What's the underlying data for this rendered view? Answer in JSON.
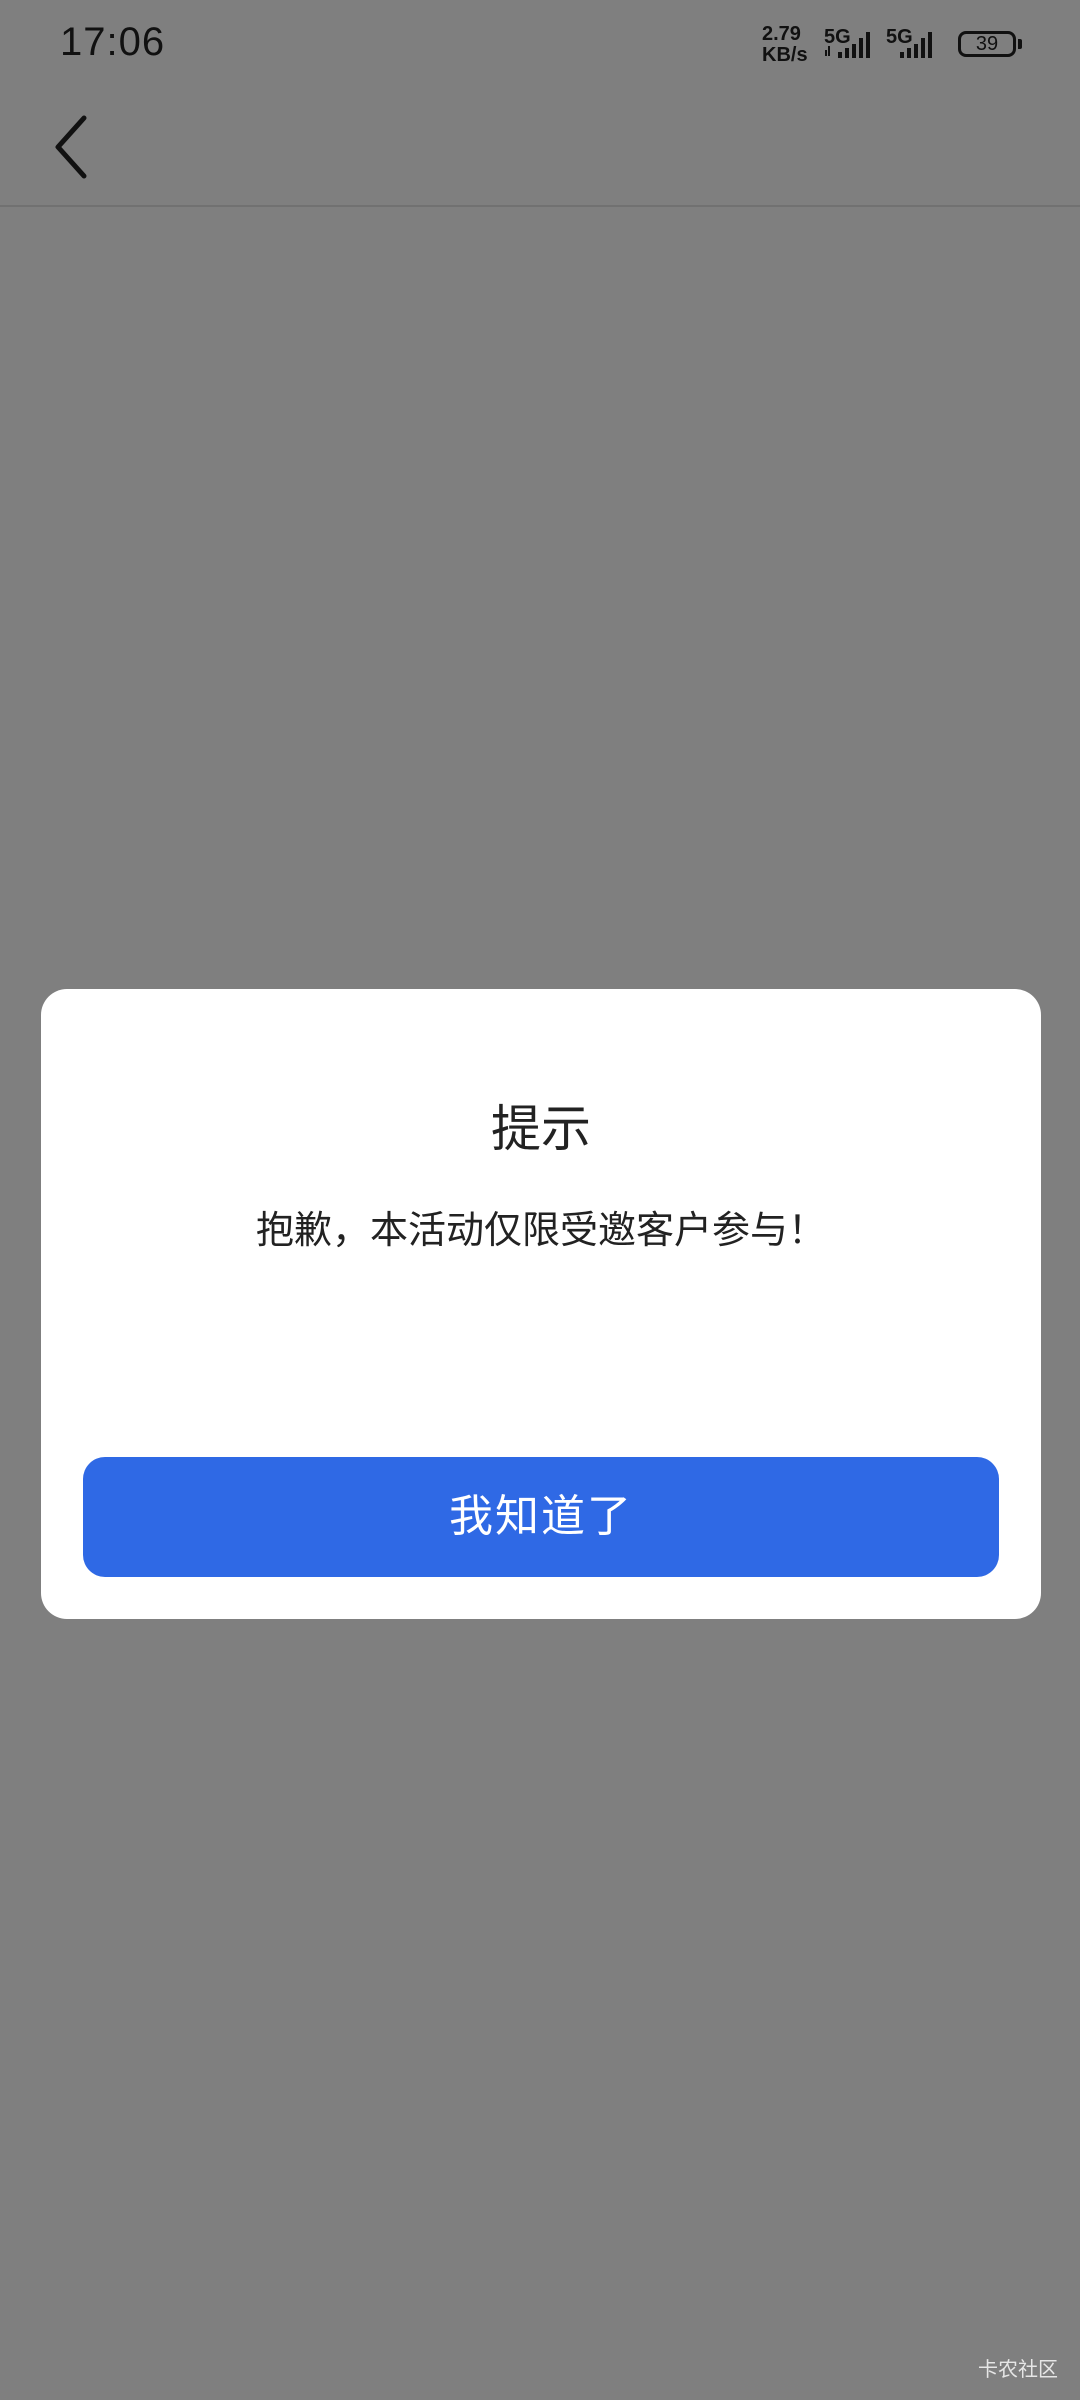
{
  "status_bar": {
    "time": "17:06",
    "net_speed_value": "2.79",
    "net_speed_unit": "KB/s",
    "sim1_network": "5G",
    "sim2_network": "5G",
    "battery_level": "39"
  },
  "dialog": {
    "title": "提示",
    "message": "抱歉，本活动仅限受邀客户参与！",
    "button_label": "我知道了",
    "button_color": "#2f69e5"
  },
  "watermark": "卡农社区",
  "icons": {
    "back": "chevron-left-icon"
  }
}
